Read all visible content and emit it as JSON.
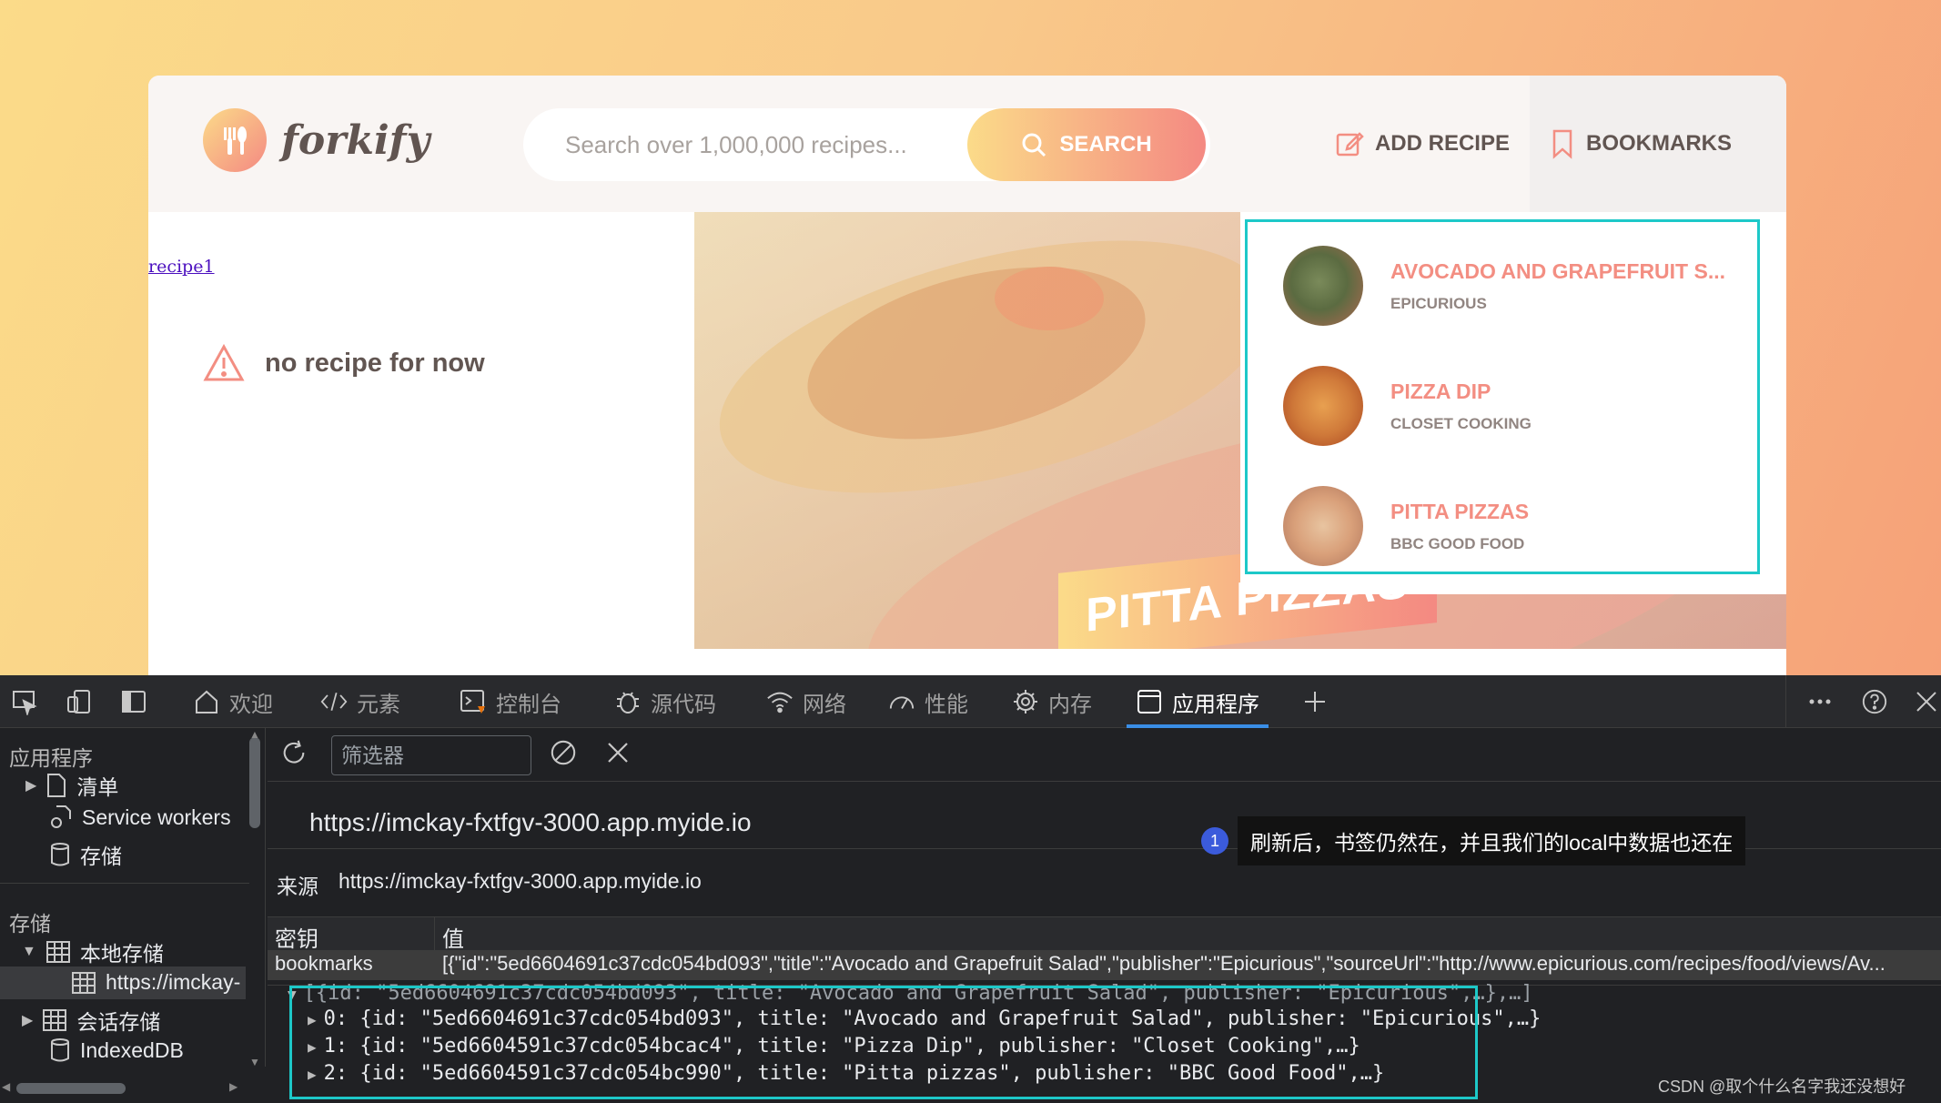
{
  "app": {
    "logo_text": "forkify",
    "search_placeholder": "Search over 1,000,000 recipes...",
    "search_button": "SEARCH",
    "add_recipe": "ADD RECIPE",
    "bookmarks": "BOOKMARKS",
    "recipe_link": "recipe1",
    "message": "no recipe for now",
    "hero_title": "PITTA PIZZAS",
    "bookmark_items": [
      {
        "title": "AVOCADO AND GRAPEFRUIT S...",
        "publisher": "EPICURIOUS"
      },
      {
        "title": "PIZZA DIP",
        "publisher": "CLOSET COOKING"
      },
      {
        "title": "PITTA PIZZAS",
        "publisher": "BBC GOOD FOOD"
      }
    ]
  },
  "devtools": {
    "tabs": [
      "欢迎",
      "元素",
      "控制台",
      "源代码",
      "网络",
      "性能",
      "内存",
      "应用程序"
    ],
    "active_tab": "应用程序",
    "sidebar": {
      "section_app": "应用程序",
      "manifest": "清单",
      "service_workers": "Service workers",
      "storage": "存储",
      "section_storage": "存储",
      "local_storage": "本地存储",
      "local_origin": "https://imckay-",
      "session_storage": "会话存储",
      "indexeddb": "IndexedDB"
    },
    "filter_placeholder": "筛选器",
    "origin_url": "https://imckay-fxtfgv-3000.app.myide.io",
    "origin_label": "来源",
    "origin_value": "https://imckay-fxtfgv-3000.app.myide.io",
    "table": {
      "col_key": "密钥",
      "col_value": "值",
      "row_key": "bookmarks",
      "row_value": "[{\"id\":\"5ed6604691c37cdc054bd093\",\"title\":\"Avocado and Grapefruit Salad\",\"publisher\":\"Epicurious\",\"sourceUrl\":\"http://www.epicurious.com/recipes/food/views/Av..."
    },
    "preview": {
      "summary": "[{id: \"5ed6604691c37cdc054bd093\", title: \"Avocado and Grapefruit Salad\", publisher: \"Epicurious\",…},…]",
      "items": [
        "0: {id: \"5ed6604691c37cdc054bd093\", title: \"Avocado and Grapefruit Salad\", publisher: \"Epicurious\",…}",
        "1: {id: \"5ed6604591c37cdc054bcac4\", title: \"Pizza Dip\", publisher: \"Closet Cooking\",…}",
        "2: {id: \"5ed6604591c37cdc054bc990\", title: \"Pitta pizzas\", publisher: \"BBC Good Food\",…}"
      ]
    },
    "annotation_number": "1",
    "annotation_text": "刷新后，书签仍然在，并且我们的local中数据也还在"
  },
  "watermark": "CSDN @取个什么名字我还没想好",
  "colors": {
    "accent": "#f38e82",
    "gradient_start": "#fbdb89",
    "gradient_end": "#f48982",
    "highlight_frame": "#1dc8c8",
    "devtools_bg": "#202124"
  }
}
